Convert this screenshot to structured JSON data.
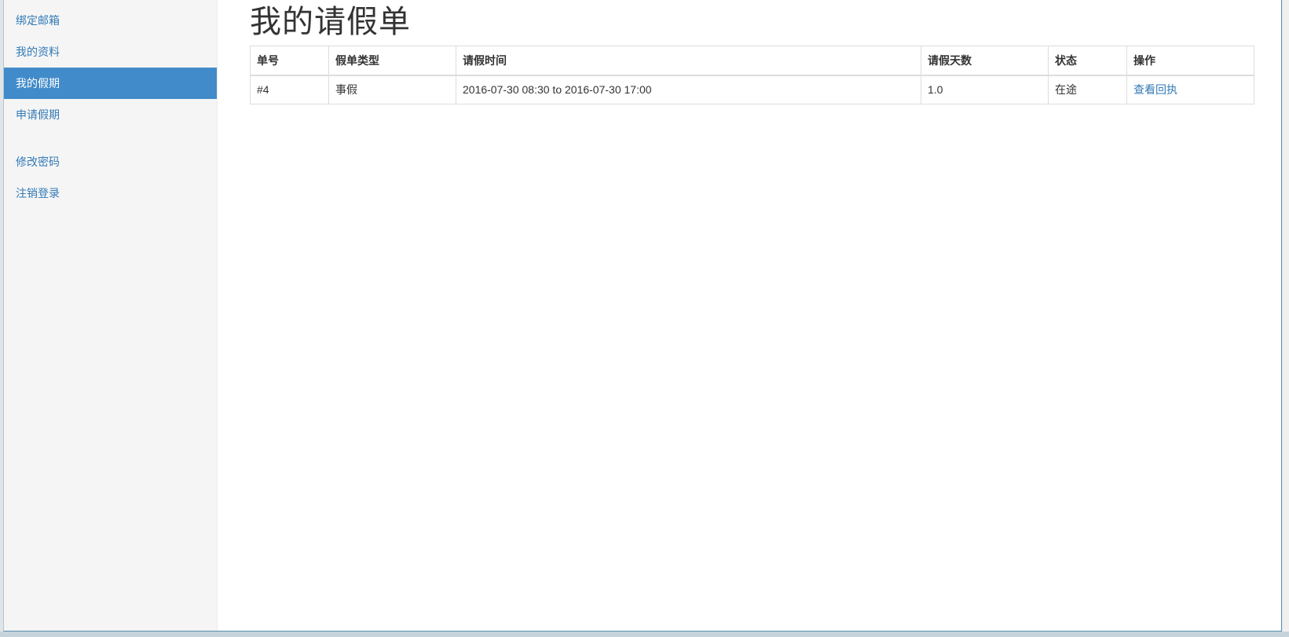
{
  "sidebar": {
    "top_items": [
      {
        "label": "绑定邮箱"
      },
      {
        "label": "我的资料"
      },
      {
        "label": "我的假期",
        "active": true
      },
      {
        "label": "申请假期"
      }
    ],
    "bottom_items": [
      {
        "label": "修改密码"
      },
      {
        "label": "注销登录"
      }
    ]
  },
  "main": {
    "title": "我的请假单",
    "table": {
      "headers": [
        "单号",
        "假单类型",
        "请假时间",
        "请假天数",
        "状态",
        "操作"
      ],
      "rows": [
        {
          "id": "#4",
          "type": "事假",
          "time": "2016-07-30 08:30 to 2016-07-30 17:00",
          "days": "1.0",
          "status": "在途",
          "action": "查看回执"
        }
      ]
    }
  },
  "colors": {
    "accent": "#428bca",
    "link": "#337ab7",
    "sidebar_bg": "#f5f5f5",
    "border": "#dddddd"
  }
}
